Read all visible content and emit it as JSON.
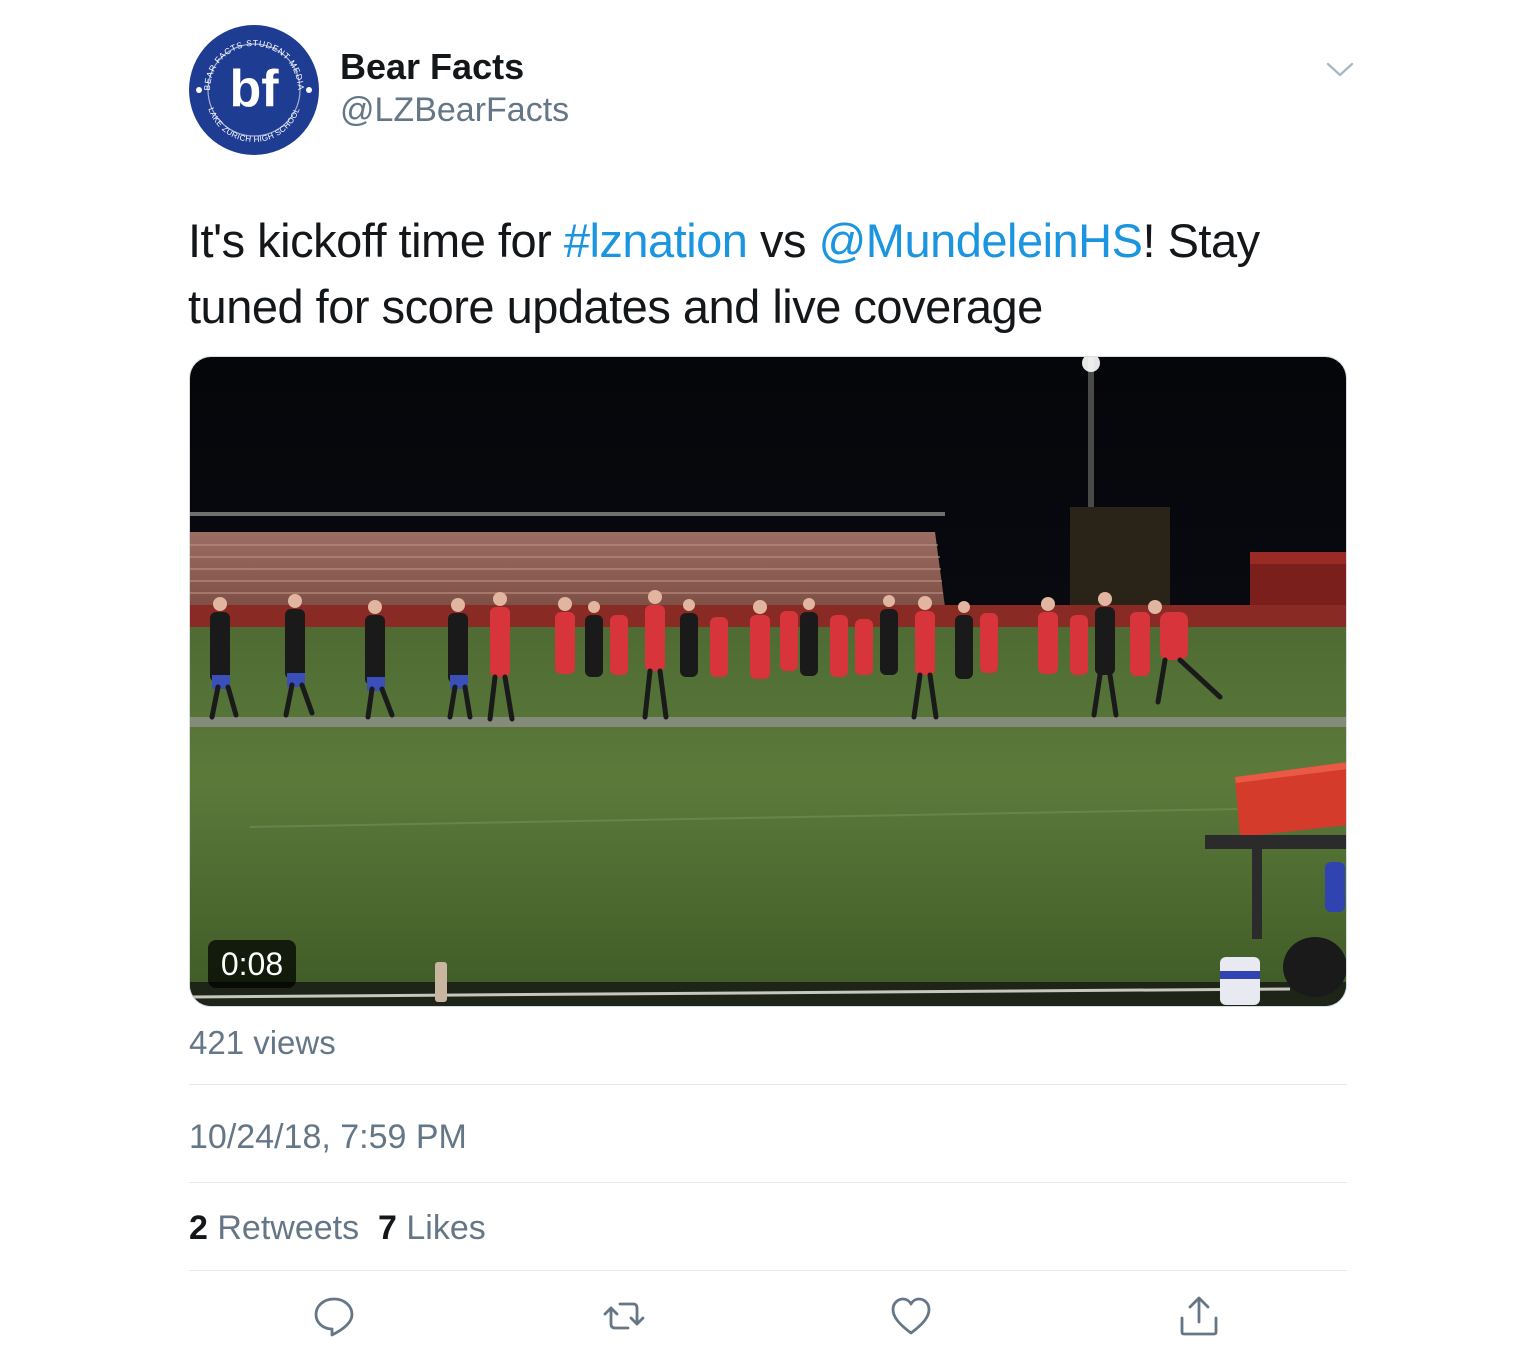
{
  "tweet": {
    "author": {
      "display_name": "Bear Facts",
      "handle": "@LZBearFacts",
      "avatar": {
        "monogram": "bf",
        "ring_text_top": "BEAR FACTS STUDENT MEDIA",
        "ring_text_bottom": "LAKE ZURICH HIGH SCHOOL",
        "color": "#1f3c93"
      }
    },
    "text": {
      "part1": "It's kickoff time for ",
      "hashtag": "#lznation",
      "part2": " vs ",
      "mention": "@MundeleinHS",
      "part3": "! Stay tuned for score updates and live coverage"
    },
    "video": {
      "duration": "0:08",
      "views": "421 views"
    },
    "timestamp": "10/24/18, 7:59 PM",
    "stats": {
      "retweets_count": "2",
      "retweets_label": "Retweets",
      "likes_count": "7",
      "likes_label": "Likes"
    },
    "actions": [
      "reply-icon",
      "retweet-icon",
      "like-icon",
      "share-icon"
    ]
  },
  "colors": {
    "link": "#1b95e0",
    "secondary_text": "#657786",
    "primary_text": "#14171a",
    "divider": "#e1e8ed"
  }
}
